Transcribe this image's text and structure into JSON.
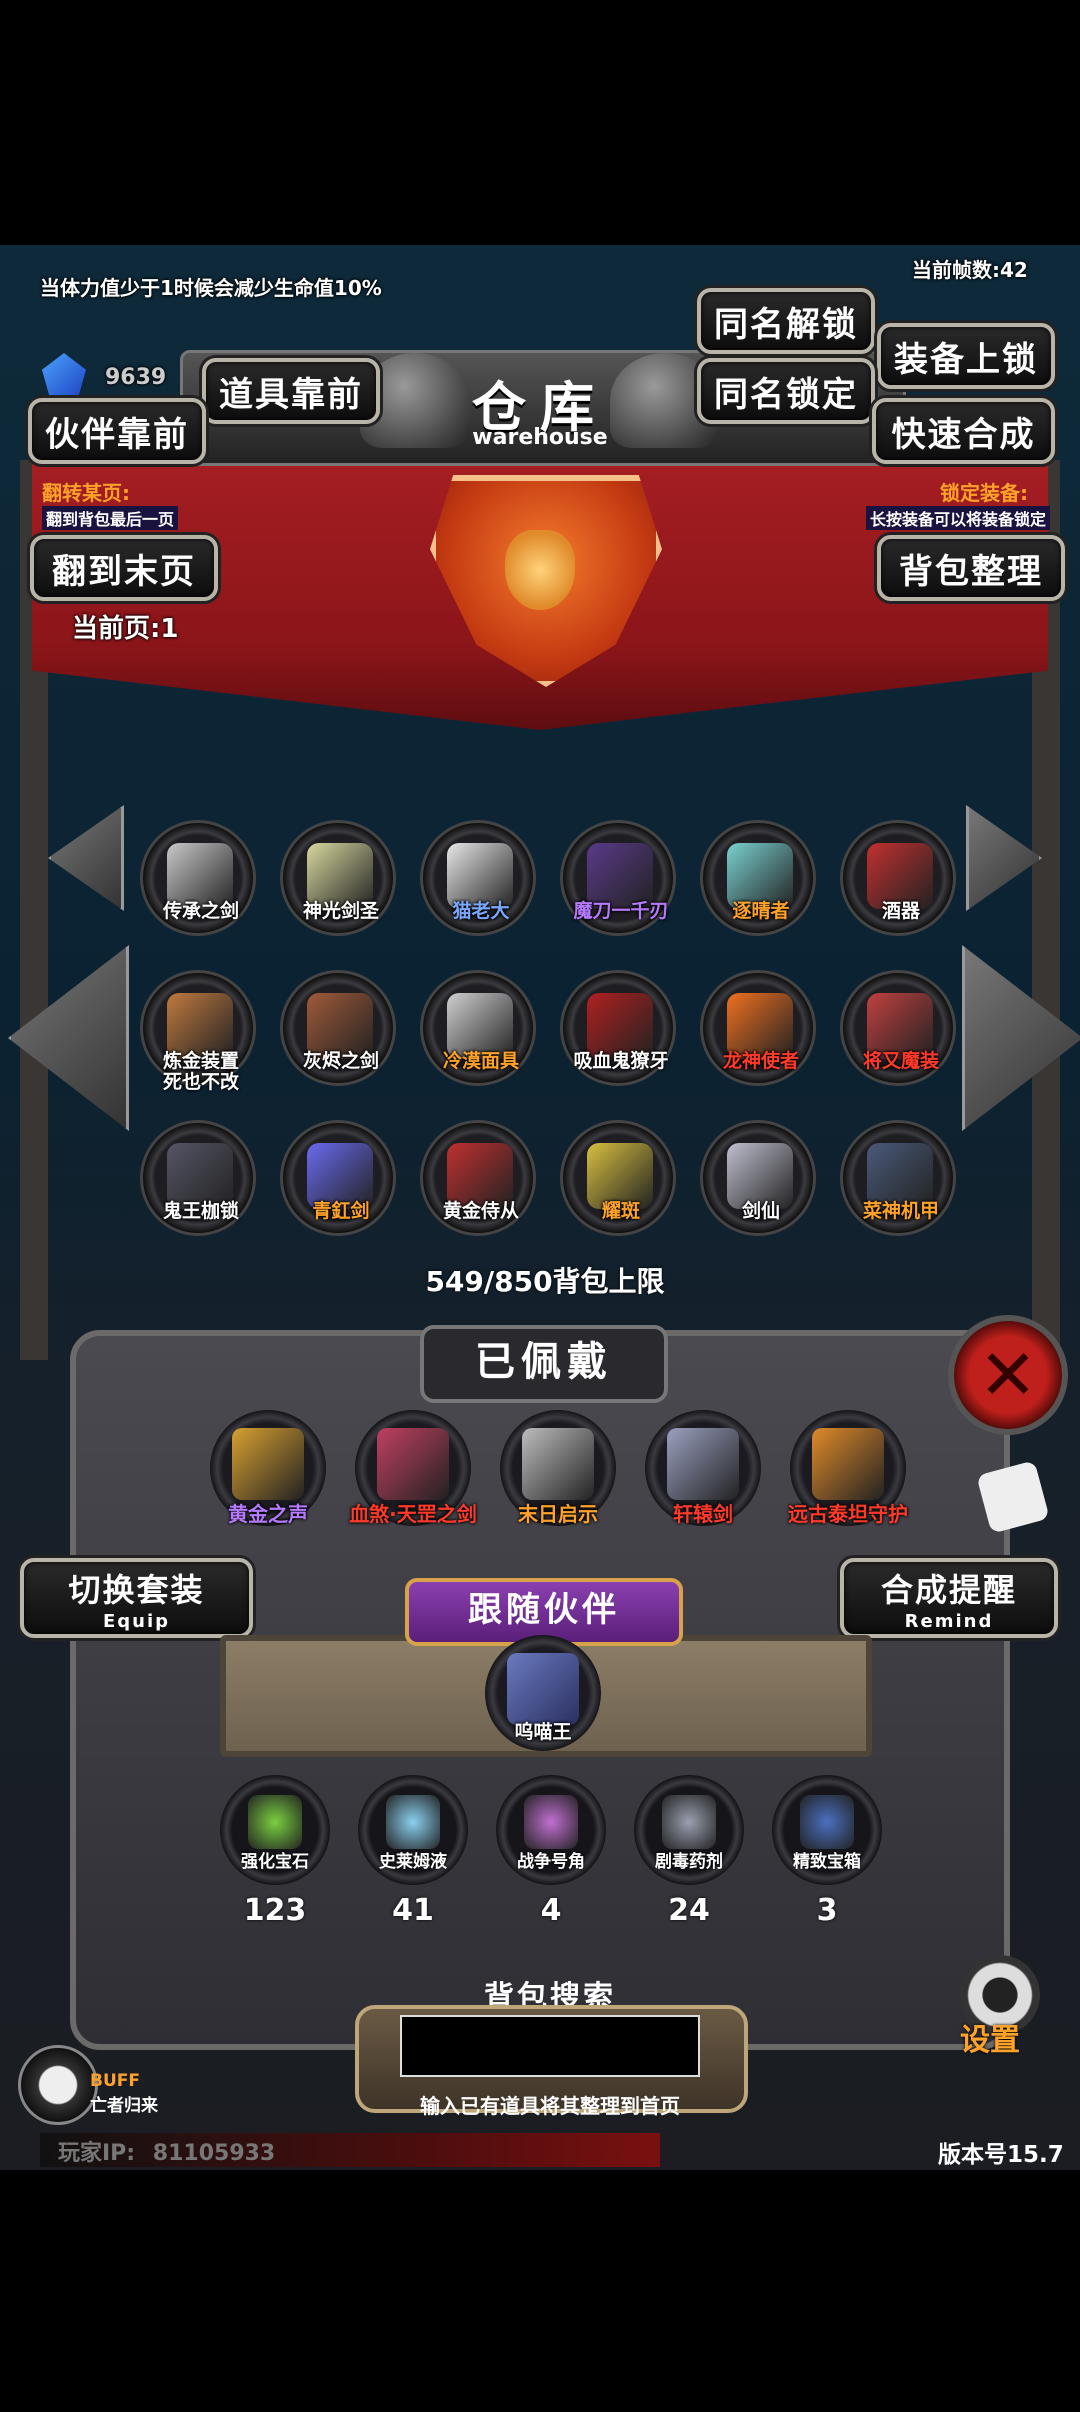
{
  "hud": {
    "warning": "当体力值少于1时候会减少生命值10%",
    "fps": "当前帧数:42",
    "gems": "9639",
    "current_page": "当前页:1",
    "player_ip_label": "玩家IP:",
    "player_ip": "81105933",
    "version": "版本号15.7"
  },
  "buttons": {
    "same_unlock": "同名解锁",
    "equip_lock": "装备上锁",
    "items_front": "道具靠前",
    "same_lock": "同名锁定",
    "partner_front": "伙伴靠前",
    "quick_merge": "快速合成",
    "last_page": "翻到末页",
    "bag_sort": "背包整理",
    "switch_set": "切换套装",
    "switch_set_sub": "Equip",
    "merge_remind": "合成提醒",
    "merge_remind_sub": "Remind",
    "settings": "设置"
  },
  "title": {
    "main": "仓库",
    "sub": "warehouse"
  },
  "tips": {
    "flip_title": "翻转某页:",
    "flip_desc": "翻到背包最后一页",
    "lock_title": "锁定装备:",
    "lock_desc": "长按装备可以将装备锁定"
  },
  "grid": [
    {
      "name": "传承之剑",
      "color": "#ffffff",
      "icon": "sword-icon",
      "tint": "#c9c9c9"
    },
    {
      "name": "神光剑圣",
      "color": "#ffffff",
      "icon": "knight-icon",
      "tint": "#d8d8a0"
    },
    {
      "name": "猫老大",
      "color": "#7aa8ff",
      "icon": "cat-icon",
      "tint": "#e8e8e8"
    },
    {
      "name": "魔刀一千刃",
      "color": "#b57aff",
      "icon": "blade-icon",
      "tint": "#5a3a8a"
    },
    {
      "name": "逐晴者",
      "color": "#ffa22a",
      "icon": "spear-icon",
      "tint": "#7ad0d0"
    },
    {
      "name": "酒器",
      "color": "#ffffff",
      "icon": "bowl-icon",
      "tint": "#c23030"
    },
    {
      "name": "炼金装置\n死也不改",
      "color": "#ffffff",
      "icon": "alchemy-icon",
      "tint": "#c07a40"
    },
    {
      "name": "灰烬之剑",
      "color": "#ffffff",
      "icon": "ash-sword-icon",
      "tint": "#a05a3a"
    },
    {
      "name": "冷漠面具",
      "color": "#ffa22a",
      "icon": "mask-icon",
      "tint": "#d0d0d0"
    },
    {
      "name": "吸血鬼獠牙",
      "color": "#ffffff",
      "icon": "fang-icon",
      "tint": "#b02020"
    },
    {
      "name": "龙神使者",
      "color": "#ff3a2a",
      "icon": "dragon-icon",
      "tint": "#f07020"
    },
    {
      "name": "将又魔装",
      "color": "#ff3a2a",
      "icon": "armor-icon",
      "tint": "#c04040"
    },
    {
      "name": "鬼王枷锁",
      "color": "#ffffff",
      "icon": "chain-icon",
      "tint": "#555566"
    },
    {
      "name": "青釭剑",
      "color": "#ffa22a",
      "icon": "blue-sword-icon",
      "tint": "#6a6af0"
    },
    {
      "name": "黄金侍从",
      "color": "#ffffff",
      "icon": "gold-servant-icon",
      "tint": "#c03030"
    },
    {
      "name": "耀斑",
      "color": "#ffa22a",
      "icon": "flare-icon",
      "tint": "#d8c040"
    },
    {
      "name": "剑仙",
      "color": "#ffffff",
      "icon": "sword-immortal-icon",
      "tint": "#c0c0d0"
    },
    {
      "name": "菜神机甲",
      "color": "#ffa22a",
      "icon": "mech-icon",
      "tint": "#4a5a7a"
    }
  ],
  "bag_capacity": "549/850背包上限",
  "equipped_title": "已佩戴",
  "equipped": [
    {
      "name": "黄金之声",
      "color": "#b57aff",
      "icon": "harp-icon",
      "tint": "#d8a030"
    },
    {
      "name": "血煞·天罡之剑",
      "color": "#ff3a2a",
      "icon": "blood-sword-icon",
      "tint": "#c04060"
    },
    {
      "name": "末日启示",
      "color": "#ffa22a",
      "icon": "doom-icon",
      "tint": "#bdbdbd"
    },
    {
      "name": "轩辕剑",
      "color": "#ff3a2a",
      "icon": "xuanyuan-icon",
      "tint": "#9aa0c0"
    },
    {
      "name": "远古泰坦守护",
      "color": "#ff3a2a",
      "icon": "titan-icon",
      "tint": "#e08a2a"
    }
  ],
  "follow": {
    "title": "跟随伙伴",
    "name": "呜喵王"
  },
  "resources": [
    {
      "name": "强化宝石",
      "count": "123",
      "icon": "gem-icon",
      "tint": "#7ad040"
    },
    {
      "name": "史莱姆液",
      "count": "41",
      "icon": "potion-icon",
      "tint": "#8ad0f0"
    },
    {
      "name": "战争号角",
      "count": "4",
      "icon": "horn-icon",
      "tint": "#c070d0"
    },
    {
      "name": "剧毒药剂",
      "count": "24",
      "icon": "poison-icon",
      "tint": "#9aa0b0"
    },
    {
      "name": "精致宝箱",
      "count": "3",
      "icon": "chest-icon",
      "tint": "#4a70c0"
    }
  ],
  "search": {
    "label": "背包搜索",
    "hint": "输入已有道具将其整理到首页",
    "value": ""
  },
  "buff": {
    "label": "BUFF",
    "name": "亡者归来"
  }
}
